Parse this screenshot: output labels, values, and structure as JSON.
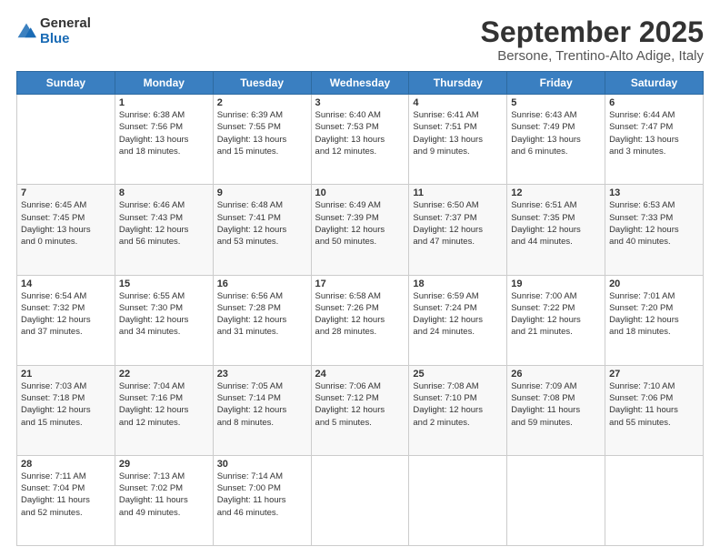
{
  "logo": {
    "general": "General",
    "blue": "Blue"
  },
  "header": {
    "month": "September 2025",
    "location": "Bersone, Trentino-Alto Adige, Italy"
  },
  "days": [
    "Sunday",
    "Monday",
    "Tuesday",
    "Wednesday",
    "Thursday",
    "Friday",
    "Saturday"
  ],
  "weeks": [
    [
      {
        "day": "",
        "lines": []
      },
      {
        "day": "1",
        "lines": [
          "Sunrise: 6:38 AM",
          "Sunset: 7:56 PM",
          "Daylight: 13 hours",
          "and 18 minutes."
        ]
      },
      {
        "day": "2",
        "lines": [
          "Sunrise: 6:39 AM",
          "Sunset: 7:55 PM",
          "Daylight: 13 hours",
          "and 15 minutes."
        ]
      },
      {
        "day": "3",
        "lines": [
          "Sunrise: 6:40 AM",
          "Sunset: 7:53 PM",
          "Daylight: 13 hours",
          "and 12 minutes."
        ]
      },
      {
        "day": "4",
        "lines": [
          "Sunrise: 6:41 AM",
          "Sunset: 7:51 PM",
          "Daylight: 13 hours",
          "and 9 minutes."
        ]
      },
      {
        "day": "5",
        "lines": [
          "Sunrise: 6:43 AM",
          "Sunset: 7:49 PM",
          "Daylight: 13 hours",
          "and 6 minutes."
        ]
      },
      {
        "day": "6",
        "lines": [
          "Sunrise: 6:44 AM",
          "Sunset: 7:47 PM",
          "Daylight: 13 hours",
          "and 3 minutes."
        ]
      }
    ],
    [
      {
        "day": "7",
        "lines": [
          "Sunrise: 6:45 AM",
          "Sunset: 7:45 PM",
          "Daylight: 13 hours",
          "and 0 minutes."
        ]
      },
      {
        "day": "8",
        "lines": [
          "Sunrise: 6:46 AM",
          "Sunset: 7:43 PM",
          "Daylight: 12 hours",
          "and 56 minutes."
        ]
      },
      {
        "day": "9",
        "lines": [
          "Sunrise: 6:48 AM",
          "Sunset: 7:41 PM",
          "Daylight: 12 hours",
          "and 53 minutes."
        ]
      },
      {
        "day": "10",
        "lines": [
          "Sunrise: 6:49 AM",
          "Sunset: 7:39 PM",
          "Daylight: 12 hours",
          "and 50 minutes."
        ]
      },
      {
        "day": "11",
        "lines": [
          "Sunrise: 6:50 AM",
          "Sunset: 7:37 PM",
          "Daylight: 12 hours",
          "and 47 minutes."
        ]
      },
      {
        "day": "12",
        "lines": [
          "Sunrise: 6:51 AM",
          "Sunset: 7:35 PM",
          "Daylight: 12 hours",
          "and 44 minutes."
        ]
      },
      {
        "day": "13",
        "lines": [
          "Sunrise: 6:53 AM",
          "Sunset: 7:33 PM",
          "Daylight: 12 hours",
          "and 40 minutes."
        ]
      }
    ],
    [
      {
        "day": "14",
        "lines": [
          "Sunrise: 6:54 AM",
          "Sunset: 7:32 PM",
          "Daylight: 12 hours",
          "and 37 minutes."
        ]
      },
      {
        "day": "15",
        "lines": [
          "Sunrise: 6:55 AM",
          "Sunset: 7:30 PM",
          "Daylight: 12 hours",
          "and 34 minutes."
        ]
      },
      {
        "day": "16",
        "lines": [
          "Sunrise: 6:56 AM",
          "Sunset: 7:28 PM",
          "Daylight: 12 hours",
          "and 31 minutes."
        ]
      },
      {
        "day": "17",
        "lines": [
          "Sunrise: 6:58 AM",
          "Sunset: 7:26 PM",
          "Daylight: 12 hours",
          "and 28 minutes."
        ]
      },
      {
        "day": "18",
        "lines": [
          "Sunrise: 6:59 AM",
          "Sunset: 7:24 PM",
          "Daylight: 12 hours",
          "and 24 minutes."
        ]
      },
      {
        "day": "19",
        "lines": [
          "Sunrise: 7:00 AM",
          "Sunset: 7:22 PM",
          "Daylight: 12 hours",
          "and 21 minutes."
        ]
      },
      {
        "day": "20",
        "lines": [
          "Sunrise: 7:01 AM",
          "Sunset: 7:20 PM",
          "Daylight: 12 hours",
          "and 18 minutes."
        ]
      }
    ],
    [
      {
        "day": "21",
        "lines": [
          "Sunrise: 7:03 AM",
          "Sunset: 7:18 PM",
          "Daylight: 12 hours",
          "and 15 minutes."
        ]
      },
      {
        "day": "22",
        "lines": [
          "Sunrise: 7:04 AM",
          "Sunset: 7:16 PM",
          "Daylight: 12 hours",
          "and 12 minutes."
        ]
      },
      {
        "day": "23",
        "lines": [
          "Sunrise: 7:05 AM",
          "Sunset: 7:14 PM",
          "Daylight: 12 hours",
          "and 8 minutes."
        ]
      },
      {
        "day": "24",
        "lines": [
          "Sunrise: 7:06 AM",
          "Sunset: 7:12 PM",
          "Daylight: 12 hours",
          "and 5 minutes."
        ]
      },
      {
        "day": "25",
        "lines": [
          "Sunrise: 7:08 AM",
          "Sunset: 7:10 PM",
          "Daylight: 12 hours",
          "and 2 minutes."
        ]
      },
      {
        "day": "26",
        "lines": [
          "Sunrise: 7:09 AM",
          "Sunset: 7:08 PM",
          "Daylight: 11 hours",
          "and 59 minutes."
        ]
      },
      {
        "day": "27",
        "lines": [
          "Sunrise: 7:10 AM",
          "Sunset: 7:06 PM",
          "Daylight: 11 hours",
          "and 55 minutes."
        ]
      }
    ],
    [
      {
        "day": "28",
        "lines": [
          "Sunrise: 7:11 AM",
          "Sunset: 7:04 PM",
          "Daylight: 11 hours",
          "and 52 minutes."
        ]
      },
      {
        "day": "29",
        "lines": [
          "Sunrise: 7:13 AM",
          "Sunset: 7:02 PM",
          "Daylight: 11 hours",
          "and 49 minutes."
        ]
      },
      {
        "day": "30",
        "lines": [
          "Sunrise: 7:14 AM",
          "Sunset: 7:00 PM",
          "Daylight: 11 hours",
          "and 46 minutes."
        ]
      },
      {
        "day": "",
        "lines": []
      },
      {
        "day": "",
        "lines": []
      },
      {
        "day": "",
        "lines": []
      },
      {
        "day": "",
        "lines": []
      }
    ]
  ]
}
